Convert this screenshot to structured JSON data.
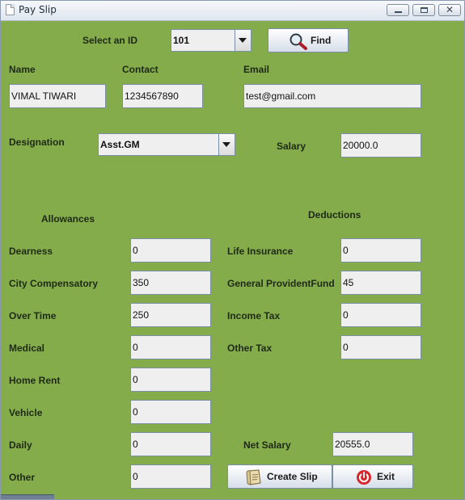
{
  "window": {
    "title": "Pay Slip"
  },
  "header": {
    "select_id_label": "Select an ID",
    "id_value": "101",
    "find_label": "Find",
    "name_label": "Name",
    "contact_label": "Contact",
    "email_label": "Email",
    "name_value": "VIMAL TIWARI",
    "contact_value": "1234567890",
    "email_value": "test@gmail.com",
    "designation_label": "Designation",
    "designation_value": "Asst.GM",
    "salary_label": "Salary",
    "salary_value": "20000.0"
  },
  "allowances": {
    "heading": "Allowances",
    "items": [
      {
        "label": "Dearness",
        "value": "0"
      },
      {
        "label": "City Compensatory",
        "value": "350"
      },
      {
        "label": "Over Time",
        "value": "250"
      },
      {
        "label": "Medical",
        "value": "0"
      },
      {
        "label": "Home Rent",
        "value": "0"
      },
      {
        "label": "Vehicle",
        "value": "0"
      },
      {
        "label": "Daily",
        "value": "0"
      },
      {
        "label": "Other",
        "value": "0"
      }
    ]
  },
  "deductions": {
    "heading": "Deductions",
    "items": [
      {
        "label": "Life Insurance",
        "value": "0"
      },
      {
        "label": "General ProvidentFund",
        "value": "45"
      },
      {
        "label": "Income Tax",
        "value": "0"
      },
      {
        "label": "Other Tax",
        "value": "0"
      }
    ]
  },
  "footer": {
    "net_salary_label": "Net Salary",
    "net_salary_value": "20555.0",
    "create_slip_label": "Create Slip",
    "exit_label": "Exit"
  },
  "icons": {
    "title": "document-icon",
    "find": "magnifier-icon",
    "create_slip": "scroll-icon",
    "exit": "power-icon"
  },
  "colors": {
    "background": "#85ac4a",
    "field": "#efefef",
    "field_border": "#7a8ea6",
    "exit_icon": "#d8262c"
  }
}
